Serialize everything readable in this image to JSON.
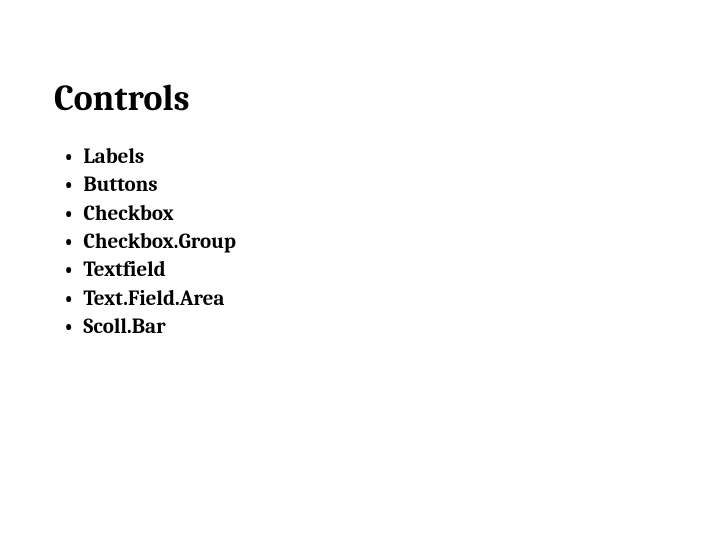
{
  "title": "Controls",
  "items": [
    "Labels",
    "Buttons",
    "Checkbox",
    "Checkbox.Group",
    "Textfield",
    "Text.Field.Area",
    "Scoll.Bar"
  ]
}
